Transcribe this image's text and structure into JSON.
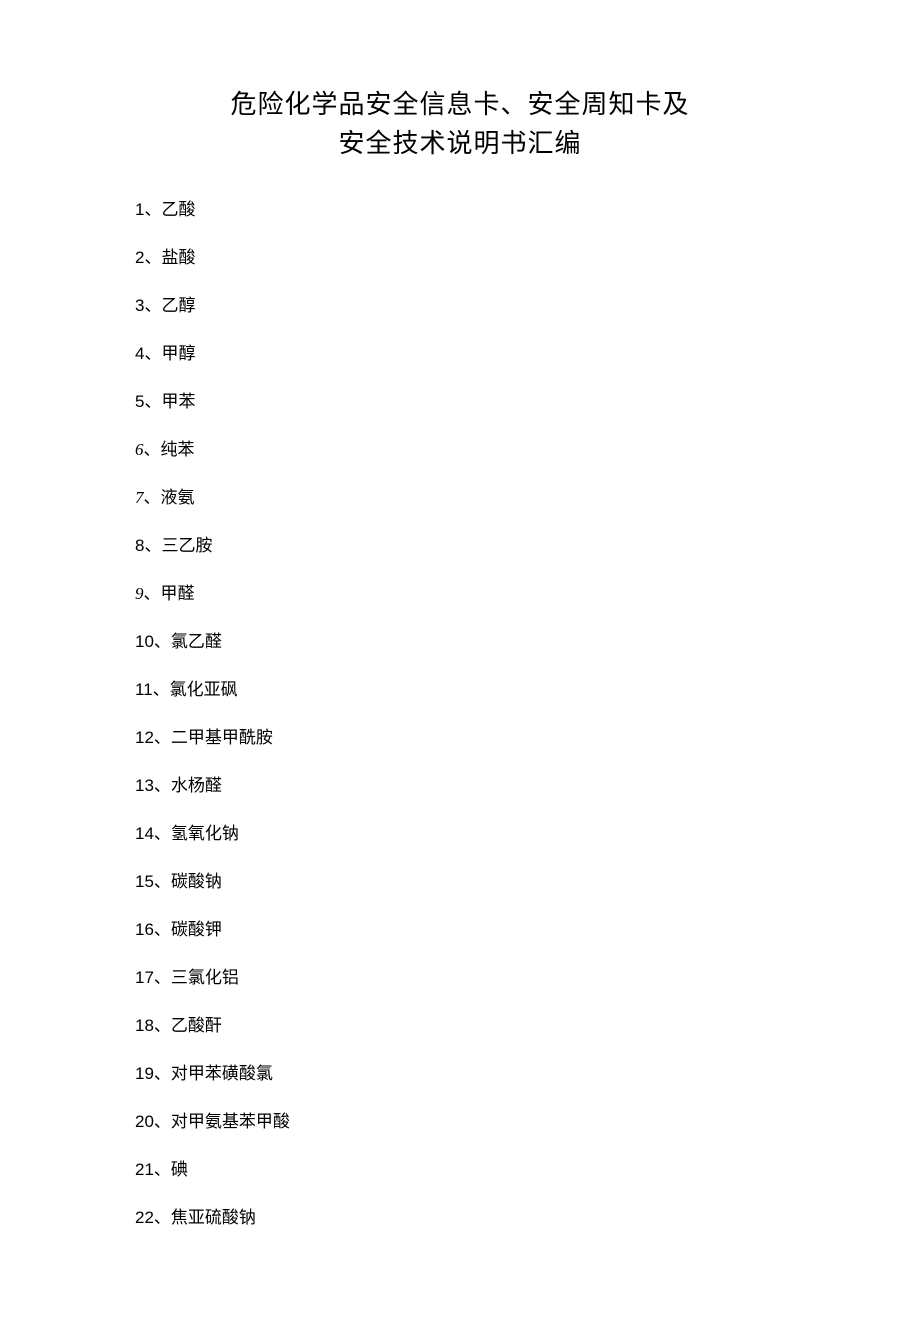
{
  "title": {
    "line1": "危险化学品安全信息卡、安全周知卡及",
    "line2": "安全技术说明书汇编"
  },
  "items": [
    {
      "num": "1",
      "sep": "、",
      "name": "乙酸",
      "italic": false
    },
    {
      "num": "2",
      "sep": "、",
      "name": "盐酸",
      "italic": false
    },
    {
      "num": "3",
      "sep": "、",
      "name": "乙醇",
      "italic": false
    },
    {
      "num": "4",
      "sep": "、",
      "name": "甲醇",
      "italic": false
    },
    {
      "num": "5",
      "sep": "、",
      "name": "甲苯",
      "italic": false
    },
    {
      "num": "6",
      "sep": "、",
      "name": "纯苯",
      "italic": true
    },
    {
      "num": "7",
      "sep": "、",
      "name": "液氨",
      "italic": true
    },
    {
      "num": "8",
      "sep": "、",
      "name": "三乙胺",
      "italic": false
    },
    {
      "num": "9",
      "sep": "、",
      "name": "甲醛",
      "italic": true
    },
    {
      "num": "10",
      "sep": "、",
      "name": "氯乙醛",
      "italic": false
    },
    {
      "num": "11",
      "sep": "、",
      "name": "氯化亚砜",
      "italic": false
    },
    {
      "num": "12",
      "sep": "、",
      "name": "二甲基甲酰胺",
      "italic": false
    },
    {
      "num": "13",
      "sep": "、",
      "name": "水杨醛",
      "italic": false
    },
    {
      "num": "14",
      "sep": "、",
      "name": "氢氧化钠",
      "italic": false
    },
    {
      "num": "15",
      "sep": "、",
      "name": "碳酸钠",
      "italic": false
    },
    {
      "num": "16",
      "sep": "、",
      "name": "碳酸钾",
      "italic": false
    },
    {
      "num": "17",
      "sep": "、",
      "name": "三氯化铝",
      "italic": false
    },
    {
      "num": "18",
      "sep": "、",
      "name": "乙酸酐",
      "italic": false
    },
    {
      "num": "19",
      "sep": "、",
      "name": "对甲苯磺酸氯",
      "italic": false
    },
    {
      "num": "20",
      "sep": "、",
      "name": "对甲氨基苯甲酸",
      "italic": false
    },
    {
      "num": "21",
      "sep": "、",
      "name": "碘",
      "italic": false
    },
    {
      "num": "22",
      "sep": "、",
      "name": "焦亚硫酸钠",
      "italic": false
    }
  ]
}
